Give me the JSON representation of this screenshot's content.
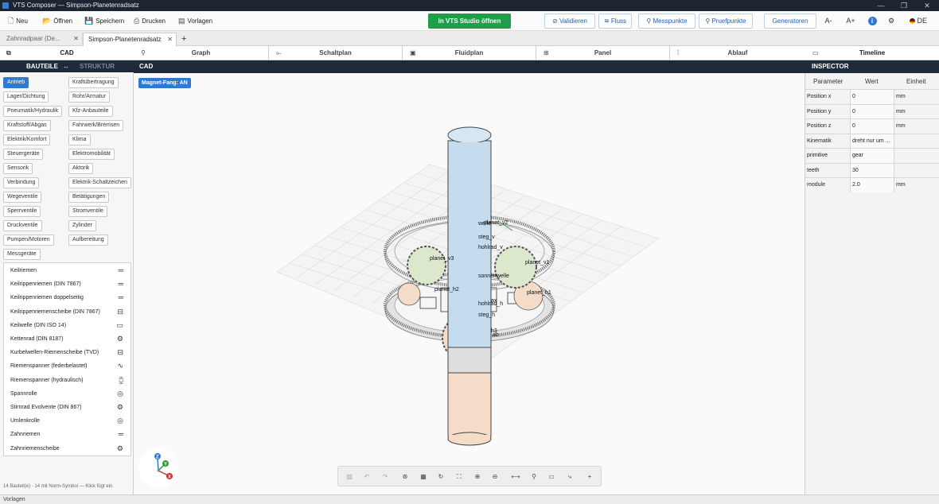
{
  "window": {
    "title": "VTS Composer — Simpson-Planetenradsatz"
  },
  "toolbar": {
    "new": "Neu",
    "open": "Öffnen",
    "save": "Speichern",
    "print": "Drucken",
    "templates": "Vorlagen",
    "open_studio": "In VTS Studio öffnen",
    "validate": "Validieren",
    "flow": "Fluss",
    "measure_points": "Messpunkte",
    "test_points": "Pruefpunkte",
    "generators": "Generatoren",
    "font_smaller": "A-",
    "font_larger": "A+",
    "language": "DE"
  },
  "tabs": [
    {
      "label": "Zahnradpaar (De..."
    },
    {
      "label": "Simpson-Planetenradsatz"
    }
  ],
  "left_panel": {
    "tab": "CAD",
    "sub_tabs": {
      "parts": "BAUTEILE",
      "swap": "↔",
      "structure": "STRUKTUR"
    },
    "categories": [
      "Antrieb",
      "Kraftübertragung",
      "Lager/Dichtung",
      "Rohr/Armatur",
      "Pneumatik/Hydraulik",
      "Kfz-Anbauteile",
      "Kraftstoff/Abgas",
      "Fahrwerk/Bremsen",
      "Elektrik/Komfort",
      "Klima",
      "Steuergeräte",
      "Elektromobilität",
      "Sensorik",
      "Aktorik",
      "Verbindung",
      "Elektrik-Schaltzeichen",
      "Wegeventile",
      "Betätigungen",
      "Sperrventile",
      "Stromventile",
      "Druckventile",
      "Zylinder",
      "Pumpen/Motoren",
      "Aufbereitung",
      "Messgeräte"
    ],
    "selected_category": "Antrieb",
    "parts": [
      "Keilriemen",
      "Keilrippenriemen (DIN 7867)",
      "Keilrippenriemen doppelseitig",
      "Keilrippenriemenscheibe (DIN 7867)",
      "Keilwelle (DIN ISO 14)",
      "Kettenrad (DIN 8187)",
      "Kurbelwellen-Riemenscheibe (TVD)",
      "Riemenspanner (federbelastet)",
      "Riemenspanner (hydraulisch)",
      "Spannrolle",
      "Stirnrad Evolvente (DIN 867)",
      "Umlenkrolle",
      "Zahnriemen",
      "Zahnriemenscheibe"
    ],
    "footer": "14 Bauteil(e) · 14 mit Norm-Symbol — Klick fügt ein."
  },
  "view_tabs": [
    "Graph",
    "Schaltplan",
    "Fluidplan",
    "Panel",
    "Ablauf"
  ],
  "viewport": {
    "header": "CAD",
    "magnet": "Magnet-Fang: AN",
    "labels": {
      "planet_v2": "planet_v2",
      "welle": "welle",
      "steg_v": "steg_v",
      "hohlrad_v": "hohlrad_v",
      "planet_v3": "planet_v3",
      "planet_v1": "planet_v1",
      "sonne_welle": "sonnenwelle",
      "planet_h2": "planet_h2",
      "planet_h1": "planet_h1",
      "hohlrad_h": "hohlrad_h",
      "steg_h": "steg_h",
      "h3": "h3",
      "ab": "ab",
      "ax": "ax"
    },
    "axis": {
      "z": "Z",
      "y": "Y",
      "x": "X"
    }
  },
  "inspector": {
    "tab": "Timeline",
    "header": "INSPECTOR",
    "columns": [
      "Parameter",
      "Wert",
      "Einheit"
    ],
    "rows": [
      {
        "param": "Position x",
        "value": "0",
        "unit": "mm"
      },
      {
        "param": "Position y",
        "value": "0",
        "unit": "mm"
      },
      {
        "param": "Position z",
        "value": "0",
        "unit": "mm"
      },
      {
        "param": "Kinematik",
        "value": "dreht nur um ...",
        "unit": ""
      },
      {
        "param": "primitive",
        "value": "gear",
        "unit": ""
      },
      {
        "param": "teeth",
        "value": "30",
        "unit": ""
      },
      {
        "param": "module",
        "value": "2.0",
        "unit": "mm"
      }
    ]
  },
  "status": "Vorlagen"
}
